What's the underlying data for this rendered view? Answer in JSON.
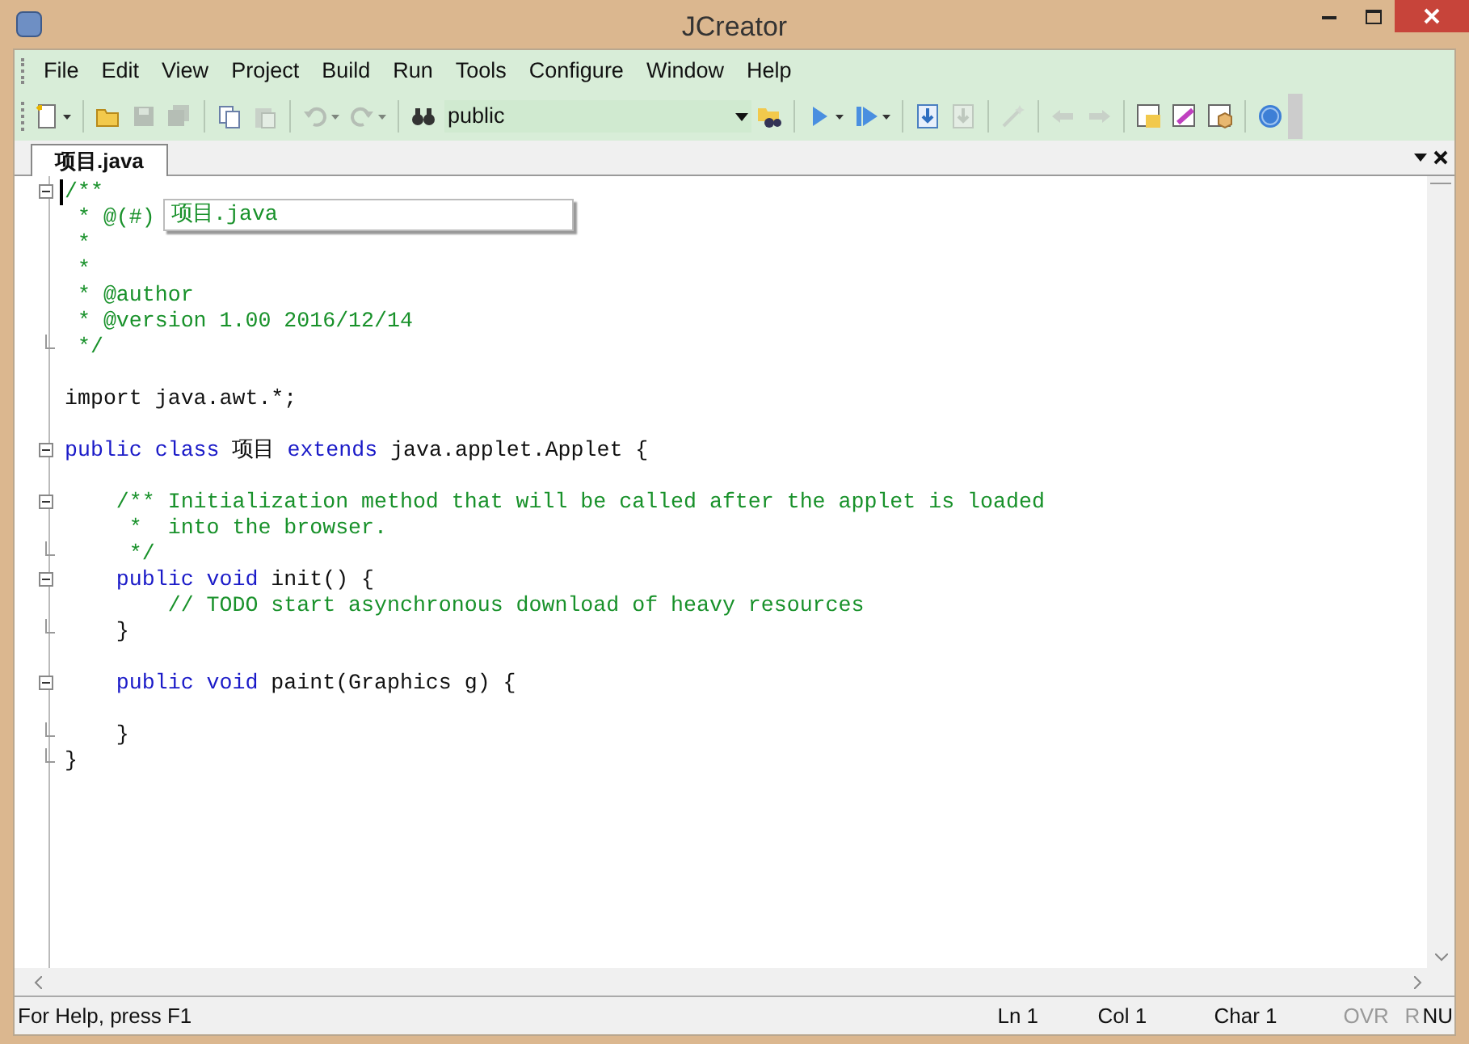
{
  "window": {
    "title": "JCreator"
  },
  "menu": [
    "File",
    "Edit",
    "View",
    "Project",
    "Build",
    "Run",
    "Tools",
    "Configure",
    "Window",
    "Help"
  ],
  "toolbar": [
    {
      "kind": "new",
      "disabled": false,
      "dropdown": true
    },
    {
      "kind": "sep"
    },
    {
      "kind": "open",
      "disabled": false,
      "dropdown": false
    },
    {
      "kind": "save",
      "disabled": true,
      "dropdown": false
    },
    {
      "kind": "saveall",
      "disabled": true,
      "dropdown": false
    },
    {
      "kind": "sep"
    },
    {
      "kind": "copy",
      "disabled": false,
      "dropdown": false
    },
    {
      "kind": "paste",
      "disabled": true,
      "dropdown": false
    },
    {
      "kind": "sep"
    },
    {
      "kind": "undo",
      "disabled": true,
      "dropdown": true
    },
    {
      "kind": "redo",
      "disabled": true,
      "dropdown": true
    },
    {
      "kind": "sep"
    },
    {
      "kind": "find",
      "disabled": false,
      "dropdown": false
    },
    {
      "kind": "combo",
      "value": "public"
    },
    {
      "kind": "findfiles",
      "disabled": false,
      "dropdown": false
    },
    {
      "kind": "sep"
    },
    {
      "kind": "run",
      "disabled": false,
      "dropdown": true
    },
    {
      "kind": "debug",
      "disabled": false,
      "dropdown": true
    },
    {
      "kind": "sep"
    },
    {
      "kind": "stepin",
      "disabled": false,
      "dropdown": false
    },
    {
      "kind": "stepout",
      "disabled": true,
      "dropdown": false
    },
    {
      "kind": "sep"
    },
    {
      "kind": "wand",
      "disabled": true,
      "dropdown": false
    },
    {
      "kind": "sep"
    },
    {
      "kind": "back",
      "disabled": true,
      "dropdown": false
    },
    {
      "kind": "forward",
      "disabled": true,
      "dropdown": false
    },
    {
      "kind": "sep"
    },
    {
      "kind": "win1",
      "disabled": false,
      "dropdown": false
    },
    {
      "kind": "win2",
      "disabled": false,
      "dropdown": false
    },
    {
      "kind": "win3",
      "disabled": false,
      "dropdown": false
    },
    {
      "kind": "sep"
    },
    {
      "kind": "help",
      "disabled": false,
      "dropdown": false
    }
  ],
  "tabs": [
    {
      "label": "项目.java",
      "selected": true
    }
  ],
  "code": [
    {
      "kind": "start",
      "parts": [
        {
          "kind": "comment",
          "text": "/**"
        }
      ]
    },
    {
      "kind": "inner",
      "parts": [
        {
          "kind": "comment",
          "text": " * @(#)"
        }
      ]
    },
    {
      "kind": "inner",
      "parts": [
        {
          "kind": "comment",
          "text": " *"
        }
      ]
    },
    {
      "kind": "inner",
      "parts": [
        {
          "kind": "comment",
          "text": " *"
        }
      ]
    },
    {
      "kind": "inner",
      "parts": [
        {
          "kind": "comment",
          "text": " * @author"
        }
      ]
    },
    {
      "kind": "inner",
      "parts": [
        {
          "kind": "comment",
          "text": " * @version 1.00 2016/12/14"
        }
      ]
    },
    {
      "kind": "end",
      "parts": [
        {
          "kind": "comment",
          "text": " */"
        }
      ]
    },
    {
      "kind": "inner"
    },
    {
      "kind": "inner",
      "parts": [
        {
          "kind": "plain",
          "text": "import java.awt.*;"
        }
      ]
    },
    {
      "kind": "inner"
    },
    {
      "kind": "start",
      "parts": [
        {
          "kind": "keyword",
          "text": "public class "
        },
        {
          "kind": "plain",
          "text": "项目 "
        },
        {
          "kind": "keyword",
          "text": "extends "
        },
        {
          "kind": "plain",
          "text": "java.applet.Applet {"
        }
      ]
    },
    {
      "kind": "inner"
    },
    {
      "kind": "start",
      "parts": [
        {
          "kind": "comment",
          "text": "    /** Initialization method that will be called after the applet is loaded"
        }
      ]
    },
    {
      "kind": "inner",
      "parts": [
        {
          "kind": "comment",
          "text": "     *  into the browser."
        }
      ]
    },
    {
      "kind": "end",
      "parts": [
        {
          "kind": "comment",
          "text": "     */"
        }
      ]
    },
    {
      "kind": "start",
      "parts": [
        {
          "kind": "keyword",
          "text": "    public void "
        },
        {
          "kind": "plain",
          "text": "init() {"
        }
      ]
    },
    {
      "kind": "inner",
      "parts": [
        {
          "kind": "comment",
          "text": "        // TODO start asynchronous download of heavy resources"
        }
      ]
    },
    {
      "kind": "end",
      "parts": [
        {
          "kind": "plain",
          "text": "    }"
        }
      ]
    },
    {
      "kind": "inner"
    },
    {
      "kind": "start",
      "parts": [
        {
          "kind": "keyword",
          "text": "    public void "
        },
        {
          "kind": "plain",
          "text": "paint(Graphics g) {"
        }
      ]
    },
    {
      "kind": "inner"
    },
    {
      "kind": "end",
      "parts": [
        {
          "kind": "plain",
          "text": "    }"
        }
      ]
    },
    {
      "kind": "end",
      "parts": [
        {
          "kind": "plain",
          "text": "}"
        }
      ]
    }
  ],
  "tooltip": {
    "text": "项目.java"
  },
  "status_bar": [
    {
      "text": "For Help, press F1",
      "disabled": false
    },
    {
      "text": "Ln 1",
      "disabled": false
    },
    {
      "text": "Col 1",
      "disabled": false
    },
    {
      "text": "Char 1",
      "disabled": false
    },
    {
      "text": "OVR",
      "disabled": true
    },
    {
      "text": "R",
      "disabled": true
    },
    {
      "text": "NU",
      "disabled": false
    }
  ]
}
